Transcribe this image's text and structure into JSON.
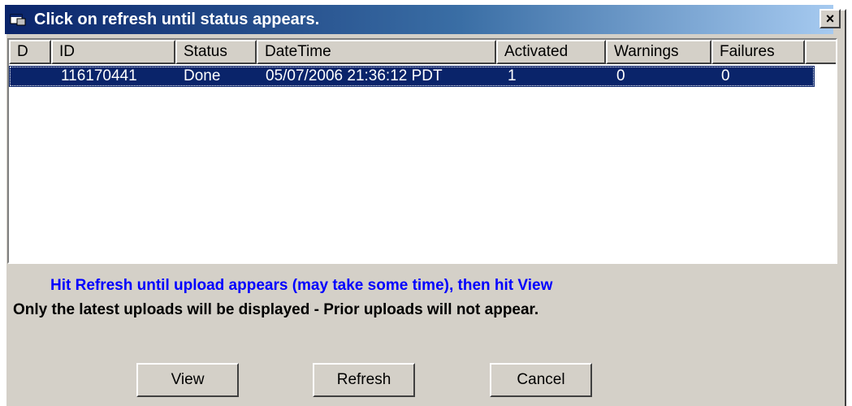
{
  "window": {
    "title": "Click on refresh until status appears.",
    "close_label": "×"
  },
  "table": {
    "columns": [
      "D",
      "ID",
      "Status",
      "DateTime",
      "Activated",
      "Warnings",
      "Failures"
    ],
    "rows": [
      {
        "d": "",
        "id": "116170441",
        "status": "Done",
        "datetime": "05/07/2006 21:36:12 PDT",
        "activated": "1",
        "warnings": "0",
        "failures": "0"
      }
    ]
  },
  "messages": {
    "instruction": "Hit Refresh until upload appears (may take some time), then hit View",
    "note": "Only the latest uploads will be displayed - Prior uploads will not appear."
  },
  "buttons": {
    "view": "View",
    "refresh": "Refresh",
    "cancel": "Cancel"
  },
  "colors": {
    "title_bar_start": "#0a246a",
    "title_bar_end": "#a6caf0",
    "selection": "#0a246a",
    "instruction_text": "#0000ff",
    "face": "#d4d0c8"
  }
}
